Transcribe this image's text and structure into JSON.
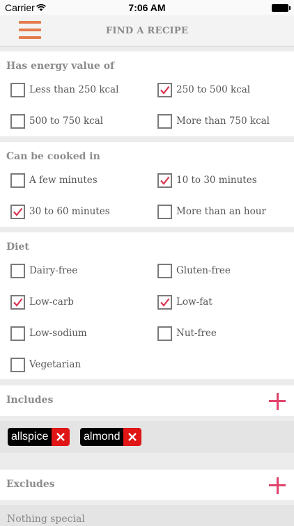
{
  "status": {
    "carrier": "Carrier",
    "time": "7:06 AM"
  },
  "nav": {
    "title": "FIND A RECIPE"
  },
  "energy": {
    "title": "Has energy value of",
    "options": [
      {
        "label": "Less than 250 kcal",
        "checked": false
      },
      {
        "label": "250 to 500 kcal",
        "checked": true
      },
      {
        "label": "500 to 750 kcal",
        "checked": false
      },
      {
        "label": "More than 750 kcal",
        "checked": false
      }
    ]
  },
  "cooked": {
    "title": "Can be cooked in",
    "options": [
      {
        "label": "A few minutes",
        "checked": false
      },
      {
        "label": "10 to 30 minutes",
        "checked": true
      },
      {
        "label": "30 to 60 minutes",
        "checked": true
      },
      {
        "label": "More than an hour",
        "checked": false
      }
    ]
  },
  "diet": {
    "title": "Diet",
    "options": [
      {
        "label": "Dairy-free",
        "checked": false
      },
      {
        "label": "Gluten-free",
        "checked": false
      },
      {
        "label": "Low-carb",
        "checked": true
      },
      {
        "label": "Low-fat",
        "checked": true
      },
      {
        "label": "Low-sodium",
        "checked": false
      },
      {
        "label": "Nut-free",
        "checked": false
      },
      {
        "label": "Vegetarian",
        "checked": false
      }
    ]
  },
  "includes": {
    "title": "Includes",
    "tags": [
      "allspice",
      "almond"
    ]
  },
  "excludes": {
    "title": "Excludes",
    "placeholder": "Nothing special"
  },
  "colors": {
    "accent": "#e0436a",
    "menu": "#e57c4e",
    "check": "#d9334f",
    "tag_remove": "#e01616"
  }
}
